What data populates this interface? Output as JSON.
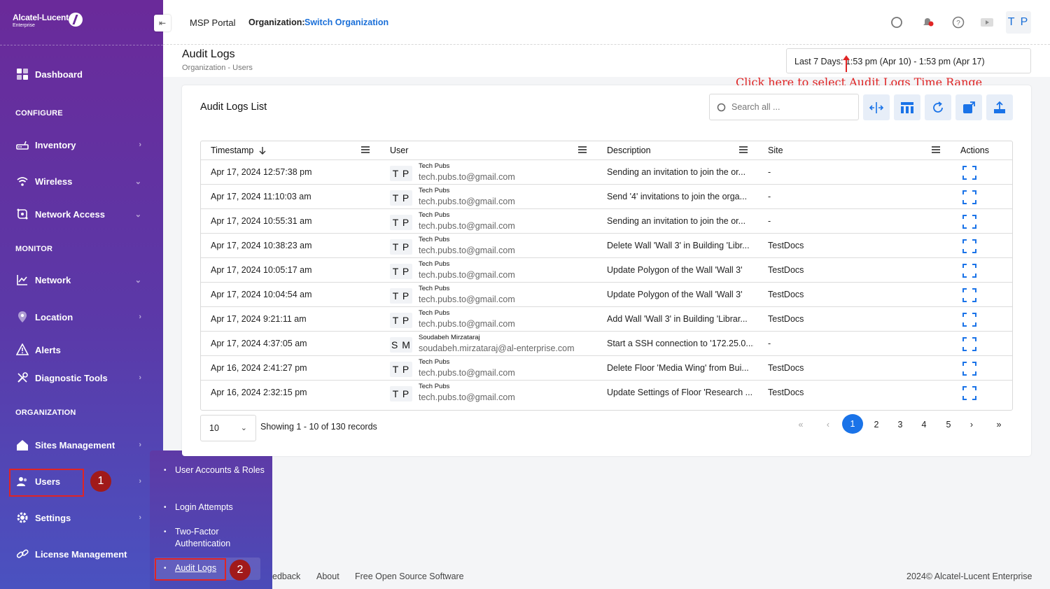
{
  "brand": {
    "name": "Alcatel-Lucent",
    "sub": "Enterprise"
  },
  "sidebar": {
    "dashboard": "Dashboard",
    "configure": "CONFIGURE",
    "inventory": "Inventory",
    "wireless": "Wireless",
    "network_access": "Network Access",
    "monitor": "MONITOR",
    "network": "Network",
    "location": "Location",
    "alerts": "Alerts",
    "diagnostic_tools": "Diagnostic Tools",
    "organization": "ORGANIZATION",
    "sites_management": "Sites Management",
    "users": "Users",
    "settings": "Settings",
    "license_management": "License Management"
  },
  "submenu": {
    "items": [
      "User Accounts & Roles",
      "Login Attempts",
      "Two-Factor Authentication",
      "Audit Logs"
    ]
  },
  "steps": {
    "one": "1",
    "two": "2"
  },
  "topbar": {
    "portal": "MSP Portal",
    "org_label": "Organization:",
    "org_link": "Switch Organization",
    "avatar": "T P"
  },
  "page": {
    "title": "Audit Logs",
    "breadcrumb": "Organization  -  Users",
    "date_range": "Last 7 Days: 1:53 pm (Apr 10) - 1:53 pm (Apr 17)",
    "annotation": "Click here to select Audit Logs Time Range"
  },
  "card": {
    "title": "Audit Logs List",
    "search_placeholder": "Search all ..."
  },
  "table": {
    "headers": {
      "timestamp": "Timestamp",
      "user": "User",
      "description": "Description",
      "site": "Site",
      "actions": "Actions"
    },
    "rows": [
      {
        "timestamp": "Apr 17, 2024 12:57:38 pm",
        "initials": "T P",
        "name": "Tech Pubs",
        "email": "tech.pubs.to@gmail.com",
        "description": "Sending an invitation to join the or...",
        "site": "-"
      },
      {
        "timestamp": "Apr 17, 2024 11:10:03 am",
        "initials": "T P",
        "name": "Tech Pubs",
        "email": "tech.pubs.to@gmail.com",
        "description": "Send '4' invitations to join the orga...",
        "site": "-"
      },
      {
        "timestamp": "Apr 17, 2024 10:55:31 am",
        "initials": "T P",
        "name": "Tech Pubs",
        "email": "tech.pubs.to@gmail.com",
        "description": "Sending an invitation to join the or...",
        "site": "-"
      },
      {
        "timestamp": "Apr 17, 2024 10:38:23 am",
        "initials": "T P",
        "name": "Tech Pubs",
        "email": "tech.pubs.to@gmail.com",
        "description": "Delete Wall 'Wall 3' in Building 'Libr...",
        "site": "TestDocs"
      },
      {
        "timestamp": "Apr 17, 2024 10:05:17 am",
        "initials": "T P",
        "name": "Tech Pubs",
        "email": "tech.pubs.to@gmail.com",
        "description": "Update Polygon of the Wall 'Wall 3'",
        "site": "TestDocs"
      },
      {
        "timestamp": "Apr 17, 2024 10:04:54 am",
        "initials": "T P",
        "name": "Tech Pubs",
        "email": "tech.pubs.to@gmail.com",
        "description": "Update Polygon of the Wall 'Wall 3'",
        "site": "TestDocs"
      },
      {
        "timestamp": "Apr 17, 2024 9:21:11 am",
        "initials": "T P",
        "name": "Tech Pubs",
        "email": "tech.pubs.to@gmail.com",
        "description": "Add Wall 'Wall 3' in Building 'Librar...",
        "site": "TestDocs"
      },
      {
        "timestamp": "Apr 17, 2024 4:37:05 am",
        "initials": "S M",
        "name": "Soudabeh Mirzataraj",
        "email": "soudabeh.mirzataraj@al-enterprise.com",
        "description": "Start a SSH connection to '172.25.0....",
        "site": "-"
      },
      {
        "timestamp": "Apr 16, 2024 2:41:27 pm",
        "initials": "T P",
        "name": "Tech Pubs",
        "email": "tech.pubs.to@gmail.com",
        "description": "Delete Floor 'Media Wing' from Bui...",
        "site": "TestDocs"
      },
      {
        "timestamp": "Apr 16, 2024 2:32:15 pm",
        "initials": "T P",
        "name": "Tech Pubs",
        "email": "tech.pubs.to@gmail.com",
        "description": "Update Settings of Floor 'Research ...",
        "site": "TestDocs"
      }
    ]
  },
  "pagination": {
    "page_size": "10",
    "showing": "Showing 1 - 10 of 130 records",
    "pages": [
      "1",
      "2",
      "3",
      "4",
      "5"
    ],
    "current": "1"
  },
  "footer": {
    "feedback": "edback",
    "about": "About",
    "foss": "Free Open Source Software",
    "copyright": "2024© Alcatel-Lucent Enterprise"
  },
  "colors": {
    "accent": "#1a73e8",
    "sidebar_top": "#6a2a9a",
    "sidebar_bottom": "#4a52c0",
    "annotation": "#e02424"
  }
}
